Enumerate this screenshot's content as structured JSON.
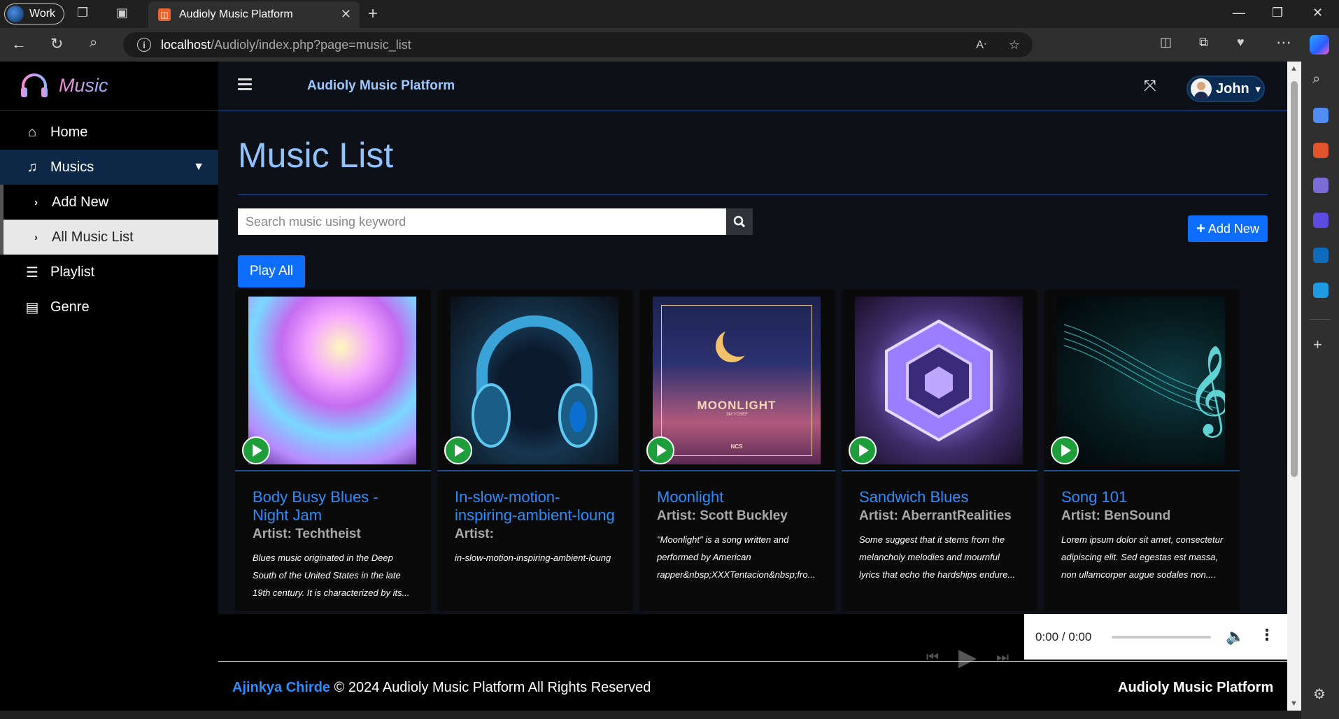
{
  "browser": {
    "profile_label": "Work",
    "tab_title": "Audioly Music Platform",
    "url_host": "localhost",
    "url_path": "/Audioly/index.php?page=music_list"
  },
  "sidebar": {
    "brand": "Music",
    "items": [
      {
        "label": "Home",
        "icon": "home-icon"
      },
      {
        "label": "Musics",
        "icon": "music-note-icon"
      },
      {
        "label": "Playlist",
        "icon": "list-icon"
      },
      {
        "label": "Genre",
        "icon": "grid-list-icon"
      }
    ],
    "sub_items": [
      {
        "label": "Add New"
      },
      {
        "label": "All Music List"
      }
    ]
  },
  "topbar": {
    "title": "Audioly Music Platform",
    "user_name": "John"
  },
  "main": {
    "heading": "Music List",
    "search_placeholder": "Search music using keyword",
    "add_new_label": "Add New",
    "play_all_label": "Play All"
  },
  "cards": [
    {
      "title": "Body Busy Blues - Night Jam",
      "artist": "Artist: Techtheist",
      "description": "Blues music originated in the Deep South of the United States in the late 19th century. It is characterized by its..."
    },
    {
      "title": "In-slow-motion-inspiring-ambient-loung",
      "artist": "Artist:",
      "description": "in-slow-motion-inspiring-ambient-loung"
    },
    {
      "title": "Moonlight",
      "artist": "Artist: Scott Buckley",
      "description": "\"Moonlight\" is a song written and performed by American rapper&nbsp;XXXTentacion&nbsp;fro...",
      "art_text": "MOONLIGHT",
      "art_subtext": "JIM YOSEF",
      "art_badge": "NCS"
    },
    {
      "title": "Sandwich Blues",
      "artist": "Artist: AberrantRealities",
      "description": "Some suggest that it stems from the melancholy melodies and mournful lyrics that echo the hardships endure..."
    },
    {
      "title": "Song 101",
      "artist": "Artist: BenSound",
      "description": "Lorem ipsum dolor sit amet, consectetur adipiscing elit. Sed egestas est massa, non ullamcorper augue sodales non...."
    }
  ],
  "player": {
    "time": "0:00 / 0:00"
  },
  "footer": {
    "author": "Ajinkya Chirde",
    "copyright": "© 2024 Audioly Music Platform All Rights Reserved",
    "brand": "Audioly Music Platform"
  }
}
